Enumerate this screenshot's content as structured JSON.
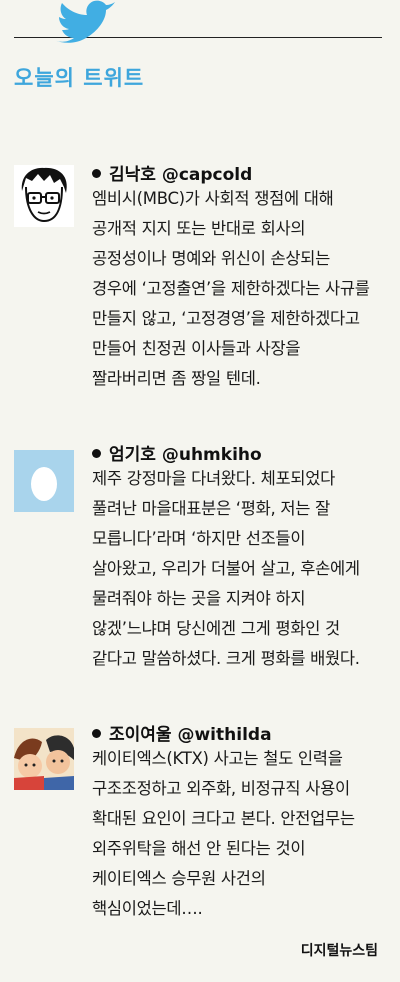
{
  "section_title": "오늘의 트위트",
  "tweets": [
    {
      "author": "김낙호 @capcold",
      "text": "엠비시(MBC)가 사회적 쟁점에 대해 공개적 지지 또는 반대로 회사의 공정성이나 명예와 위신이 손상되는 경우에 ‘고정출연’을 제한하겠다는 사규를 만들지 않고, ‘고정경영’을 제한하겠다고 만들어 친정권 이사들과 사장을 짤라버리면 좀 짱일 텐데.",
      "avatar_icon": "cartoon-face-with-glasses"
    },
    {
      "author": "엄기호 @uhmkiho",
      "text": "제주 강정마을 다녀왔다. 체포되었다 풀려난 마을대표분은 ‘평화, 저는 잘 모릅니다’라며 ‘하지만 선조들이 살아왔고, 우리가 더불어 살고, 후손에게 물려줘야 하는 곳을 지켜야 하지 않겠’느냐며 당신에겐 그게 평화인 것 같다고 말씀하셨다. 크게 평화를 배웠다.",
      "avatar_icon": "egg-avatar"
    },
    {
      "author": "조이여울 @withilda",
      "text": "케이티엑스(KTX) 사고는 철도 인력을 구조조정하고 외주화, 비정규직 사용이 확대된 요인이 크다고 본다. 안전업무는 외주위탁을 해선 안 된다는 것이 케이티엑스 승무원 사건의 핵심이었는데….",
      "avatar_icon": "anime-characters"
    }
  ],
  "credit": "디지털뉴스팀",
  "colors": {
    "accent": "#3ea6dc",
    "background": "#f5f5ef",
    "egg_bg": "#a9d4ec"
  }
}
